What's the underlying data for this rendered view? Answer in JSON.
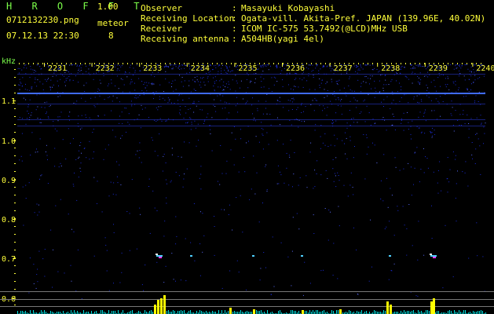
{
  "header": {
    "app_title": "H R O F F T",
    "version": "1.00",
    "filename": "0712132230.png",
    "mode_label": "meteor",
    "datetime": "07.12.13 22:30",
    "meteor_count": "8"
  },
  "station_info": [
    {
      "label": "Observer",
      "value": "Masayuki Kobayashi"
    },
    {
      "label": "Receiving Location",
      "value": "Ogata-vill. Akita-Pref. JAPAN (139.96E, 40.02N)"
    },
    {
      "label": "Receiver",
      "value": "ICOM IC-575 53.7492(@LCD)MHz USB"
    },
    {
      "label": "Receiving antenna",
      "value": "A504HB(yagi 4el)"
    }
  ],
  "chart_data": {
    "type": "heatmap",
    "y_unit": "kHz",
    "y_ticks": [
      "1.1",
      "1.0",
      "0.9",
      "0.8",
      "0.7",
      "0.6"
    ],
    "x_ticks": [
      "2231",
      "2232",
      "2233",
      "2234",
      "2235",
      "2236",
      "2237",
      "2238",
      "2239",
      "2240"
    ],
    "carrier_khz": 1.12,
    "meteor_echoes": [
      {
        "time": "2233.3",
        "khz": 0.71
      },
      {
        "time": "2234.0",
        "khz": 0.72
      },
      {
        "time": "2235.2",
        "khz": 0.71
      },
      {
        "time": "2236.1",
        "khz": 0.71
      },
      {
        "time": "2238.3",
        "khz": 0.71
      },
      {
        "time": "2239.2",
        "khz": 0.71
      }
    ],
    "colors": {
      "noise": "#1a2bd6",
      "carrier": "#3f6bff",
      "echo": "#ff3bff",
      "axis_text": "#ffff3a",
      "level": "#ffff00",
      "baseline": "#00e0e0"
    }
  }
}
